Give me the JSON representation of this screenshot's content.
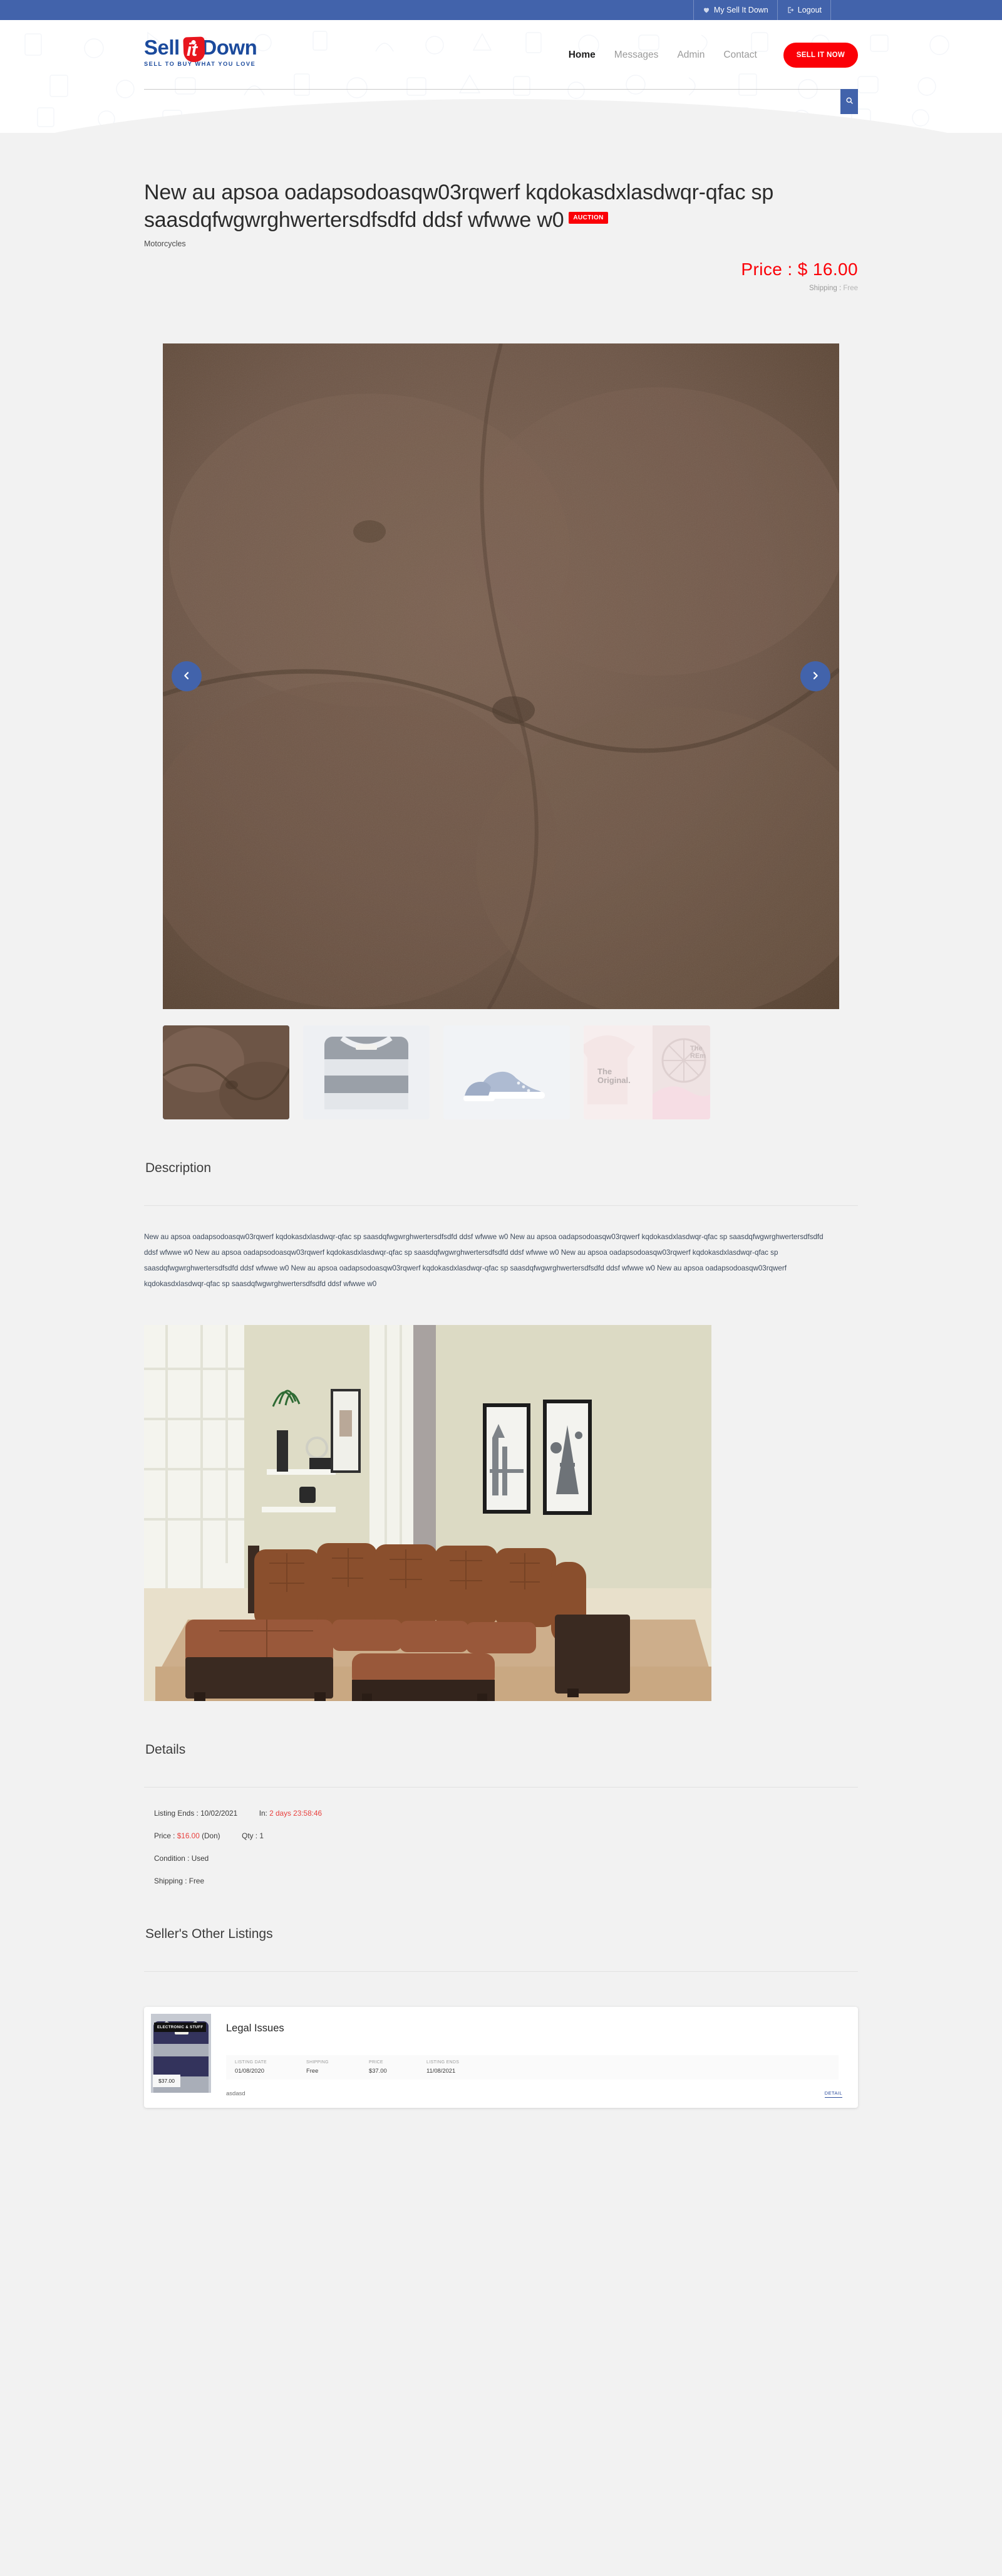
{
  "colors": {
    "brand_blue": "#4263ab",
    "brand_red": "#fb0007",
    "logo_blue": "#1b4a9c",
    "page_bg": "#f2f2f2",
    "price_red": "#fb0007",
    "countdown_red": "#e8413e",
    "link_blue": "#2f4f9e"
  },
  "topbar": {
    "links": [
      {
        "label": "My Sell It Down",
        "icon": "heart-icon"
      },
      {
        "label": "Logout",
        "icon": "logout-icon"
      }
    ]
  },
  "header": {
    "logo": {
      "word_one": "Sell",
      "word_tag": "it",
      "word_two": "Down",
      "tagline": "SELL TO BUY WHAT YOU LOVE"
    },
    "nav": [
      {
        "label": "Home",
        "active": true
      },
      {
        "label": "Messages",
        "active": false
      },
      {
        "label": "Admin",
        "active": false
      },
      {
        "label": "Contact",
        "active": false
      }
    ],
    "cta_label": "SELL IT NOW",
    "search": {
      "value": "",
      "placeholder": "",
      "icon": "search-icon"
    }
  },
  "product": {
    "title": "New au apsoa oadapsodoasqw03rqwerf kqdokasdxlasdwqr-qfac sp saasdqfwgwrghwertersdfsdfd ddsf wfwwe w0",
    "badge": "AUCTION",
    "category": "Motorcycles",
    "price_label": "Price :",
    "price_value": "$ 16.00",
    "shipping_label": "Shipping :",
    "shipping_value": "Free"
  },
  "carousel": {
    "prev_icon": "chevron-left-icon",
    "next_icon": "chevron-right-icon",
    "thumbnails": [
      {
        "name": "brown-suede-sofa-closeup",
        "active": true
      },
      {
        "name": "grey-knit-sweater",
        "active": false
      },
      {
        "name": "blue-canvas-sneakers",
        "active": false
      },
      {
        "name": "the-original-tshirt",
        "active": false
      }
    ]
  },
  "description": {
    "heading": "Description",
    "body": "New au apsoa oadapsodoasqw03rqwerf kqdokasdxlasdwqr-qfac sp saasdqfwgwrghwertersdfsdfd ddsf wfwwe w0 New au apsoa oadapsodoasqw03rqwerf kqdokasdxlasdwqr-qfac sp saasdqfwgwrghwertersdfsdfd ddsf wfwwe w0 New au apsoa oadapsodoasqw03rqwerf kqdokasdxlasdwqr-qfac sp saasdqfwgwrghwertersdfsdfd ddsf wfwwe w0 New au apsoa oadapsodoasqw03rqwerf kqdokasdxlasdwqr-qfac sp saasdqfwgwrghwertersdfsdfd ddsf wfwwe w0 New au apsoa oadapsodoasqw03rqwerf kqdokasdxlasdwqr-qfac sp saasdqfwgwrghwertersdfsdfd ddsf wfwwe w0 New au apsoa oadapsodoasqw03rqwerf kqdokasdxlasdwqr-qfac sp saasdqfwgwrghwertersdfsdfd ddsf wfwwe w0",
    "image_name": "brown-sectional-sofa-in-living-room"
  },
  "details": {
    "heading": "Details",
    "listing_ends_label": "Listing Ends :",
    "listing_ends_value": "10/02/2021",
    "in_label": "In:",
    "countdown": "2 days 23:58:46",
    "price_label": "Price :",
    "price_value": "$16.00",
    "price_suffix": "(Don)",
    "qty_label": "Qty :",
    "qty_value": "1",
    "condition_label": "Condition :",
    "condition_value": "Used",
    "shipping_label": "Shipping :",
    "shipping_value": "Free"
  },
  "seller_listings": {
    "heading": "Seller's Other Listings",
    "items": [
      {
        "category_badge": "ELECTRONIC & STUFF",
        "price_badge": "$37.00",
        "title": "Legal Issues",
        "meta": [
          {
            "label": "LISTING DATE",
            "value": "01/08/2020"
          },
          {
            "label": "SHIPPING",
            "value": "Free"
          },
          {
            "label": "PRICE",
            "value": "$37.00"
          },
          {
            "label": "LISTING ENDS",
            "value": "11/08/2021"
          }
        ],
        "description": "asdasd",
        "detail_link": "DETAIL"
      }
    ]
  }
}
